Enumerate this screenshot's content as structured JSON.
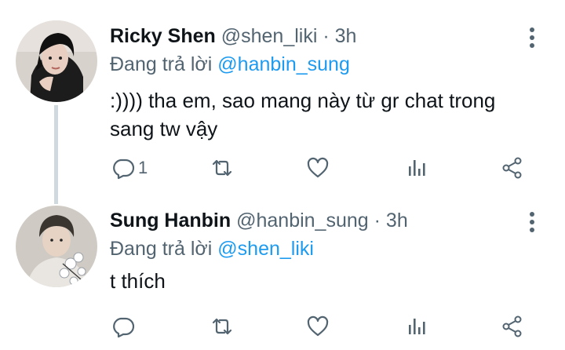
{
  "tweets": [
    {
      "name": "Ricky Shen",
      "handle": "@shen_liki",
      "separator": "·",
      "time": "3h",
      "reply_prefix": "Đang trả lời",
      "reply_to": "@hanbin_sung",
      "text": ":)))) tha em, sao mang này từ gr chat trong sang tw vậy",
      "reply_count": "1"
    },
    {
      "name": "Sung Hanbin",
      "handle": "@hanbin_sung",
      "separator": "·",
      "time": "3h",
      "reply_prefix": "Đang trả lời",
      "reply_to": "@shen_liki",
      "text": "t thích",
      "reply_count": ""
    }
  ],
  "icons": {
    "reply": "reply-icon",
    "retweet": "retweet-icon",
    "like": "heart-icon",
    "views": "analytics-icon",
    "share": "share-icon",
    "more": "more-vertical-icon"
  },
  "colors": {
    "text": "#0f1419",
    "secondary": "#536471",
    "mention": "#1d9bf0",
    "thread_line": "#cfd9de"
  }
}
